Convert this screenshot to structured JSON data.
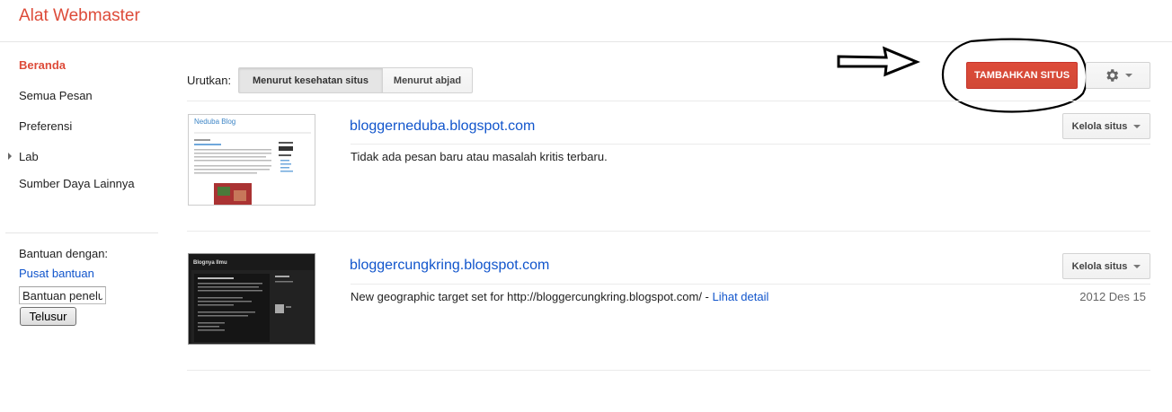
{
  "header": {
    "app_title": "Alat Webmaster"
  },
  "sidebar": {
    "items": [
      {
        "label": "Beranda"
      },
      {
        "label": "Semua Pesan"
      },
      {
        "label": "Preferensi"
      },
      {
        "label": "Lab"
      },
      {
        "label": "Sumber Daya Lainnya"
      }
    ],
    "help": {
      "label": "Bantuan dengan:",
      "link": "Pusat bantuan",
      "input_value": "Bantuan penelu",
      "search_button": "Telusur"
    }
  },
  "toolbar": {
    "sort_label": "Urutkan:",
    "sort_options": [
      "Menurut kesehatan situs",
      "Menurut abjad"
    ],
    "add_site_button": "TAMBAHKAN SITUS",
    "settings_icon": "gear-icon"
  },
  "sites": [
    {
      "url": "bloggerneduba.blogspot.com",
      "manage_label": "Kelola situs",
      "message": "Tidak ada pesan baru atau masalah kritis terbaru.",
      "thumb_title": "Neduba Blog"
    },
    {
      "url": "bloggercungkring.blogspot.com",
      "manage_label": "Kelola situs",
      "message": "New geographic target set for http://bloggercungkring.blogspot.com/ - ",
      "message_link": "Lihat detail",
      "date": "2012 Des 15",
      "thumb_title": "Blognya Ilmu"
    }
  ],
  "colors": {
    "brand": "#dd4b39",
    "link": "#1155cc",
    "add_button": "#d14836"
  }
}
